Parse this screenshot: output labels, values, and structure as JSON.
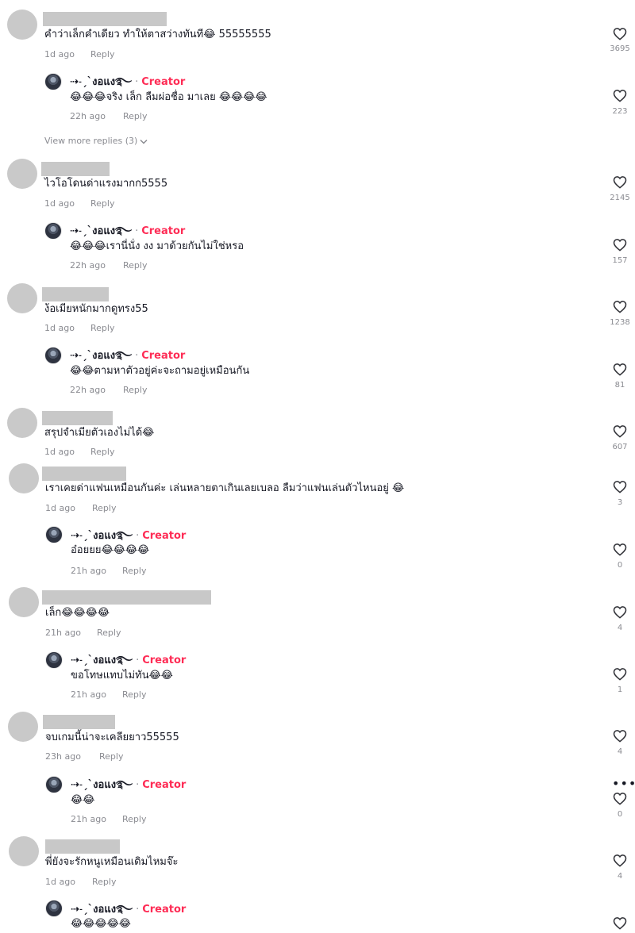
{
  "labels": {
    "reply": "Reply",
    "creator_badge": "Creator",
    "separator": "·"
  },
  "creator": {
    "name": "⇢˗ˏˋงอแง࿐"
  },
  "view_more": "View more replies (3)",
  "comments": [
    {
      "text": "คำว่าเล็กคำเดียว ทำให้ตาสว่างทันที😂 55555555",
      "time": "1d ago",
      "likes": "3695"
    },
    {
      "text": "ไวโอโดนด่าแรงมากก5555",
      "time": "1d ago",
      "likes": "2145"
    },
    {
      "text": "ง้อเมียหนักมากดูทรง55",
      "time": "1d ago",
      "likes": "1238"
    },
    {
      "text": "สรุปจำเมียตัวเองไม่ได้😂",
      "time": "1d ago",
      "likes": "607"
    },
    {
      "text": "เราเคยด่าแฟนเหมือนกันค่ะ เล่นหลายตาเกินเลยเบลอ ลืมว่าแฟนเล่นตัวไหนอยู่ 😂",
      "time": "1d ago",
      "likes": "3"
    },
    {
      "text": "เล็ก😂😂😂😂",
      "time": "21h ago",
      "likes": "4"
    },
    {
      "text": "จบเกมนี้น่าจะเคลียยาว55555",
      "time": "23h ago",
      "likes": "4"
    },
    {
      "text": "พี่ยังจะรักหนูเหมือนเดิมไหมจ๊ะ",
      "time": "1d ago",
      "likes": "4"
    }
  ],
  "replies": [
    {
      "text": "😂😂😂จริง เล็ก ลืมผ่อชื่อ มาเลย 😂😂😂😂",
      "time": "22h ago",
      "likes": "223"
    },
    {
      "text": "😂😂😂เรานี่นั่ง งง มาด้วยกันไม่ใช่หรอ",
      "time": "22h ago",
      "likes": "157"
    },
    {
      "text": "😂😂ตามหาตัวอยู่ค่ะจะถามอยู่เหมือนกัน",
      "time": "22h ago",
      "likes": "81"
    },
    {
      "text": "อ๋อยยย😂😂😂😂",
      "time": "21h ago",
      "likes": "0"
    },
    {
      "text": "ขอโทษแทบไม่ทัน😂😂",
      "time": "21h ago",
      "likes": "1"
    },
    {
      "text": "😂😂",
      "time": "21h ago",
      "likes": "0"
    },
    {
      "text": "😂😂😂😂😂",
      "time": "",
      "likes": ""
    }
  ]
}
